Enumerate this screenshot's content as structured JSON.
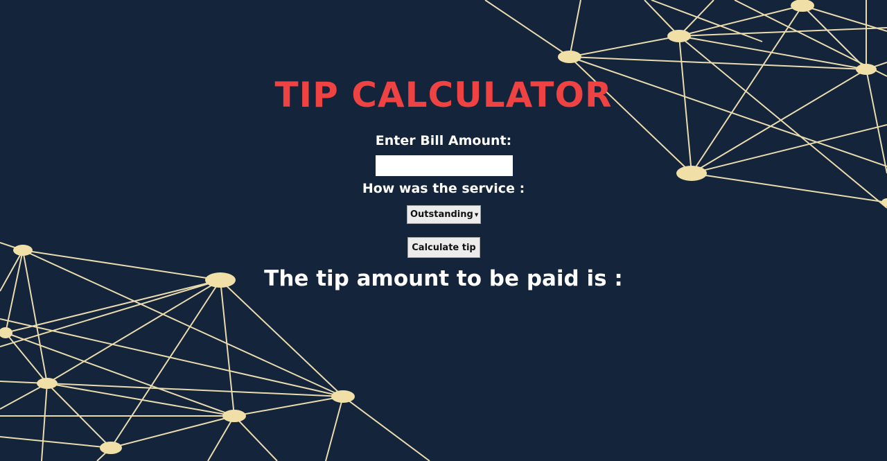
{
  "app": {
    "title": "TIP CALCULATOR"
  },
  "form": {
    "bill_label": "Enter Bill Amount:",
    "bill_value": "",
    "service_label": "How was the service :",
    "service_selected": "Outstanding",
    "calculate_label": "Calculate tip"
  },
  "result": {
    "text": "The tip amount to be paid is :"
  },
  "colors": {
    "background": "#13243b",
    "title": "#ef4242",
    "network_lines": "#eadcae",
    "network_nodes": "#f0dfa6"
  },
  "icons": {
    "select_arrow": "chevron-down-icon"
  }
}
